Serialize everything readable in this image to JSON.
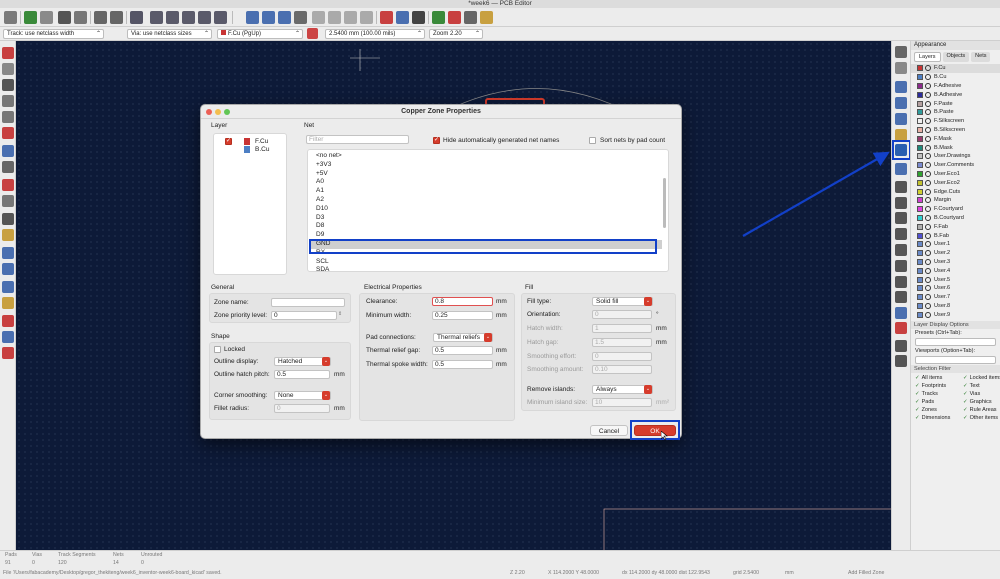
{
  "window": {
    "title": "*week6 — PCB Editor"
  },
  "toolbar": {
    "icons": [
      "save-icon",
      "board-setup-icon",
      "page-settings-icon",
      "print-icon",
      "plot-icon",
      "undo-icon",
      "redo-icon",
      "find-icon",
      "zoom-redraw-icon",
      "zoom-in-icon",
      "zoom-out-icon",
      "zoom-fit-icon",
      "zoom-object-icon",
      "rotate-ccw-icon",
      "rotate-cw-icon",
      "flip-icon",
      "mirror-icon",
      "group-icon",
      "ungroup-icon",
      "lock-icon",
      "unlock-icon",
      "netlist-icon",
      "footprint-editor-icon",
      "footprint-browser-icon",
      "3d-viewer-icon",
      "drc-icon",
      "scripting-icon",
      "python-icon"
    ]
  },
  "options_bar": {
    "track": "Track: use netclass width",
    "via": "Via: use netclass sizes",
    "layer": "F.Cu (PgUp)",
    "grid": "2.5400 mm (100.00 mils)",
    "zoom": "Zoom 2.20"
  },
  "dialog": {
    "title": "Copper Zone Properties",
    "layer_section": {
      "title": "Layer",
      "layers": [
        {
          "name": "F.Cu",
          "checked": true,
          "color": "#c83434"
        },
        {
          "name": "B.Cu",
          "checked": false,
          "color": "#4d7fc4"
        }
      ]
    },
    "net_section": {
      "title": "Net",
      "filter_placeholder": "Filter",
      "hide_auto_nets_label": "Hide automatically generated net names",
      "hide_auto_nets_checked": true,
      "sort_by_pad_label": "Sort nets by pad count",
      "sort_by_pad_checked": false,
      "nets": [
        "<no net>",
        "+3V3",
        "+5V",
        "A0",
        "A1",
        "A2",
        "D10",
        "D3",
        "D8",
        "D9",
        "GND",
        "RX",
        "SCL",
        "SDA"
      ],
      "selected": "GND"
    },
    "general": {
      "title": "General",
      "zone_name_label": "Zone name:",
      "zone_name_value": "",
      "priority_label": "Zone priority level:",
      "priority_value": "0"
    },
    "shape": {
      "title": "Shape",
      "locked_label": "Locked",
      "outline_display_label": "Outline display:",
      "outline_display_value": "Hatched",
      "hatch_pitch_label": "Outline hatch pitch:",
      "hatch_pitch_value": "0.5",
      "hatch_pitch_unit": "mm",
      "corner_smoothing_label": "Corner smoothing:",
      "corner_smoothing_value": "None",
      "fillet_radius_label": "Fillet radius:",
      "fillet_radius_value": "0",
      "fillet_radius_unit": "mm"
    },
    "electrical": {
      "title": "Electrical Properties",
      "clearance_label": "Clearance:",
      "clearance_value": "0.8",
      "clearance_unit": "mm",
      "min_width_label": "Minimum width:",
      "min_width_value": "0.25",
      "min_width_unit": "mm",
      "pad_connections_label": "Pad connections:",
      "pad_connections_value": "Thermal reliefs",
      "relief_gap_label": "Thermal relief gap:",
      "relief_gap_value": "0.5",
      "relief_gap_unit": "mm",
      "spoke_width_label": "Thermal spoke width:",
      "spoke_width_value": "0.5",
      "spoke_width_unit": "mm"
    },
    "fill": {
      "title": "Fill",
      "fill_type_label": "Fill type:",
      "fill_type_value": "Solid fill",
      "orientation_label": "Orientation:",
      "orientation_value": "0",
      "orientation_unit": "°",
      "hatch_width_label": "Hatch width:",
      "hatch_width_value": "1",
      "hatch_width_unit": "mm",
      "hatch_gap_label": "Hatch gap:",
      "hatch_gap_value": "1.5",
      "hatch_gap_unit": "mm",
      "smoothing_effort_label": "Smoothing effort:",
      "smoothing_effort_value": "0",
      "smoothing_amount_label": "Smoothing amount:",
      "smoothing_amount_value": "0.10",
      "remove_islands_label": "Remove islands:",
      "remove_islands_value": "Always",
      "min_island_label": "Minimum island size:",
      "min_island_value": "10",
      "min_island_unit": "mm²"
    },
    "buttons": {
      "cancel": "Cancel",
      "ok": "OK"
    }
  },
  "appearance": {
    "title": "Appearance",
    "tabs": [
      "Layers",
      "Objects",
      "Nets"
    ],
    "layers": [
      {
        "name": "F.Cu",
        "color": "#c83434"
      },
      {
        "name": "B.Cu",
        "color": "#4d7fc4"
      },
      {
        "name": "F.Adhesive",
        "color": "#8c2a8c"
      },
      {
        "name": "B.Adhesive",
        "color": "#2b2b9c"
      },
      {
        "name": "F.Paste",
        "color": "#b4a0a0"
      },
      {
        "name": "B.Paste",
        "color": "#2f9c9c"
      },
      {
        "name": "F.Silkscreen",
        "color": "#f0f0f0"
      },
      {
        "name": "B.Silkscreen",
        "color": "#e8b2a7"
      },
      {
        "name": "F.Mask",
        "color": "#9a3a6e"
      },
      {
        "name": "B.Mask",
        "color": "#1e8a7a"
      },
      {
        "name": "User.Drawings",
        "color": "#c2c2c2"
      },
      {
        "name": "User.Comments",
        "color": "#7a8ad0"
      },
      {
        "name": "User.Eco1",
        "color": "#2fa22f"
      },
      {
        "name": "User.Eco2",
        "color": "#c2c22f"
      },
      {
        "name": "Edge.Cuts",
        "color": "#d0d02f"
      },
      {
        "name": "Margin",
        "color": "#d040d0"
      },
      {
        "name": "F.Courtyard",
        "color": "#e040e0"
      },
      {
        "name": "B.Courtyard",
        "color": "#2fd0d0"
      },
      {
        "name": "F.Fab",
        "color": "#b0b0b0"
      },
      {
        "name": "B.Fab",
        "color": "#5050d0"
      },
      {
        "name": "User.1",
        "color": "#6a8ac8"
      },
      {
        "name": "User.2",
        "color": "#6a8ac8"
      },
      {
        "name": "User.3",
        "color": "#6a8ac8"
      },
      {
        "name": "User.4",
        "color": "#6a8ac8"
      },
      {
        "name": "User.5",
        "color": "#6a8ac8"
      },
      {
        "name": "User.6",
        "color": "#6a8ac8"
      },
      {
        "name": "User.7",
        "color": "#6a8ac8"
      },
      {
        "name": "User.8",
        "color": "#6a8ac8"
      },
      {
        "name": "User.9",
        "color": "#6a8ac8"
      }
    ],
    "layer_display_options": "Layer Display Options",
    "presets_label": "Presets (Ctrl+Tab):",
    "viewports_label": "Viewports (Option+Tab):",
    "selection_filter_title": "Selection Filter",
    "selection_filter": [
      "All items",
      "Locked items",
      "Footprints",
      "Text",
      "Tracks",
      "Vias",
      "Pads",
      "Graphics",
      "Zones",
      "Rule Areas",
      "Dimensions",
      "Other items"
    ]
  },
  "status": {
    "pads_label": "Pads",
    "pads_value": "91",
    "vias_label": "Vias",
    "vias_value": "0",
    "segments_label": "Track Segments",
    "segments_value": "120",
    "nets_label": "Nets",
    "nets_value": "14",
    "unrouted_label": "Unrouted",
    "unrouted_value": "0",
    "path": "File '/Users/fabacademy/Desktop/gregor_thekiteng/week6_inventor-week6-board_kicad' saved.",
    "zoom_readout": "Z 2.20",
    "coords": "X 114.2000  Y 48.0000",
    "delta": "dx 114.2000  dy 48.0000  dist 122.9543",
    "grid_readout": "grid 2.5400",
    "units": "mm",
    "mode": "Add Filled Zone"
  },
  "colors": {
    "canvas": "#0d1a38",
    "accent_red": "#d63c2c",
    "highlight_blue": "#1240c8"
  }
}
